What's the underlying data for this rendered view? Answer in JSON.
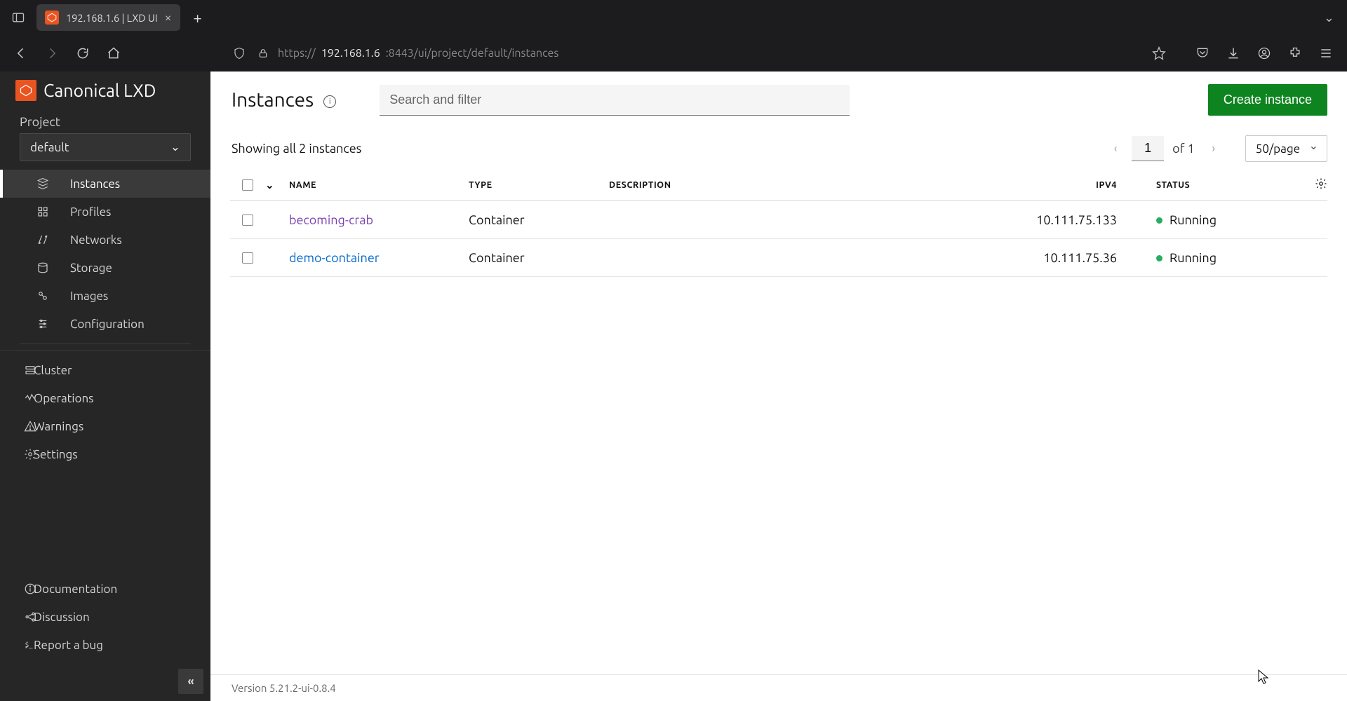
{
  "browser": {
    "tab_title": "192.168.1.6 | LXD UI",
    "url_scheme": "https://",
    "url_host": "192.168.1.6",
    "url_port_path": ":8443/ui/project/default/instances"
  },
  "sidebar": {
    "brand": "Canonical LXD",
    "project_label": "Project",
    "project_value": "default",
    "items": [
      {
        "label": "Instances"
      },
      {
        "label": "Profiles"
      },
      {
        "label": "Networks"
      },
      {
        "label": "Storage"
      },
      {
        "label": "Images"
      },
      {
        "label": "Configuration"
      }
    ],
    "items2": [
      {
        "label": "Cluster"
      },
      {
        "label": "Operations"
      },
      {
        "label": "Warnings"
      },
      {
        "label": "Settings"
      }
    ],
    "bottom": [
      {
        "label": "Documentation"
      },
      {
        "label": "Discussion"
      },
      {
        "label": "Report a bug"
      }
    ]
  },
  "header": {
    "title": "Instances",
    "search_placeholder": "Search and filter",
    "create_label": "Create instance"
  },
  "list": {
    "summary": "Showing all 2 instances",
    "page": "1",
    "of_text": "of 1",
    "perpage": "50/page",
    "columns": {
      "name": "NAME",
      "type": "TYPE",
      "description": "DESCRIPTION",
      "ipv4": "IPV4",
      "status": "STATUS"
    },
    "rows": [
      {
        "name": "becoming-crab",
        "type": "Container",
        "description": "",
        "ipv4": "10.111.75.133",
        "status": "Running",
        "visited": true
      },
      {
        "name": "demo-container",
        "type": "Container",
        "description": "",
        "ipv4": "10.111.75.36",
        "status": "Running",
        "visited": false
      }
    ]
  },
  "footer": {
    "version": "Version 5.21.2-ui-0.8.4"
  }
}
